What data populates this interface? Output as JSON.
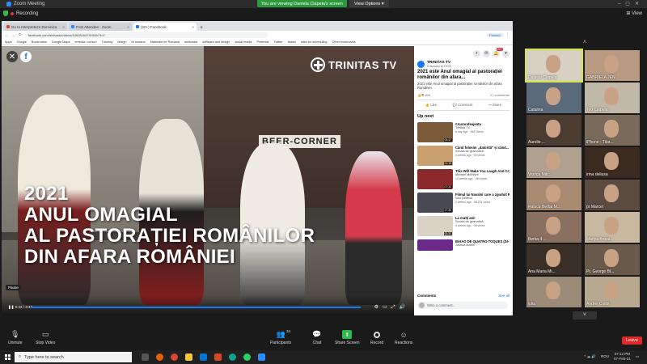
{
  "zoom": {
    "title": "Zoom Meeting",
    "share_banner": "You are viewing Daniela Ciapela's screen",
    "view_options": "View Options",
    "recording": "Recording",
    "view": "View"
  },
  "browser": {
    "tabs": [
      {
        "label": "Go to Interpreteze Dominica",
        "color": "#e53935"
      },
      {
        "label": "Post Attendee - Zoom",
        "color": "#2d8cff"
      },
      {
        "label": "(20+) Facebook",
        "color": "#1877f2"
      }
    ],
    "address": "facebook.com/trinitastv/videos/10828164731006/?t=0",
    "paused": "Paused",
    "bookmarks": [
      "Apps",
      "Google",
      "Bookmarks",
      "Google Maps",
      "emedia / cursuri",
      "Tutoring",
      "design",
      "fb romana",
      "Materiale de Romana",
      "dictionare",
      "software and design",
      "social media",
      "Pinterest",
      "Twitter",
      "teams",
      "sites for scheduling",
      "Other bookmarks"
    ]
  },
  "video": {
    "logo": "TRINITAS TV",
    "sign": "BEER-CORNER",
    "overlay_lines": [
      "2021",
      "ANUL OMAGIAL",
      "AL PASTORAȚIEI ROMÂNILOR",
      "DIN AFARA ROMÂNIEI"
    ],
    "close": "✕",
    "fb": "f",
    "pause_tip": "Pause",
    "time": "0:44 / 3:43"
  },
  "post": {
    "notif_count": "20+",
    "channel": "TRINITAS TV",
    "date": "5 January at 19:00 · ",
    "title": "2021 este Anul omagial al pastorației românilor din afara...",
    "desc": "2021 este Anul omagial al pastorației românilor din afara României",
    "reactions": "849",
    "comments_count": "27 comments",
    "like": "Like",
    "comment": "Comment",
    "share": "Share",
    "up_next": "Up next",
    "comments_label": "Comments",
    "see_all": "See all",
    "write_comment": "Write a comment..."
  },
  "up_next": [
    {
      "title": "#Aurorafeajenta",
      "channel": "Trinitas TV",
      "meta": "a day ago · 496 Views",
      "dur": "03:47",
      "color": "#7b5a3a"
    },
    {
      "title": "Când folosim „datorită\" și când...",
      "channel": "Școala de gramatică",
      "meta": "4 weeks ago · 53 views",
      "dur": "01:15",
      "color": "#c9a070"
    },
    {
      "title": "This Will Make You Laugh And Cry",
      "channel": "Michael McIntyre",
      "meta": "12 weeks ago · 4M views",
      "dur": "07:32",
      "color": "#8a2a2a"
    },
    {
      "title": "Filmul lui Navalnî care a zguduit Rusia",
      "channel": "Nou Delfinul",
      "meta": "2 weeks ago · 48,231 views",
      "dur": "17:30",
      "color": "#4a4a55"
    },
    {
      "title": "La mulți ani!",
      "channel": "Școala de gramatică",
      "meta": "3 weeks ago · 46 views",
      "dur": "00:31",
      "color": "#d9d2c5"
    },
    {
      "title": "BAIAO DE QUATRO TOQUES (Zé Miguel...",
      "channel": "Joshua Martin",
      "meta": "",
      "dur": "",
      "color": "#6b2a8a"
    }
  ],
  "participants": [
    {
      "name": "Daniela Ciapela",
      "bg": "#d8d0c2"
    },
    {
      "name": "GABRIELA JEN...",
      "bg": "#b89a80"
    },
    {
      "name": "Catalina",
      "bg": "#5a6a7a"
    },
    {
      "name": "Teo Ciapela",
      "bg": "#c2b8a8"
    },
    {
      "name": "Aurelie ...",
      "bg": "#4a3c30"
    },
    {
      "name": "iPhone - Tiba...",
      "bg": "#7a6a5a"
    },
    {
      "name": "Viorica Mitc...",
      "bg": "#b0a090"
    },
    {
      "name": "irina deliusa",
      "bg": "#3a2a20"
    },
    {
      "name": "Raluca Berba M...",
      "bg": "#a88a70"
    },
    {
      "name": "pr Marcel",
      "bg": "#5a4a40"
    },
    {
      "name": "Berka 4 ...",
      "bg": "#8a7060"
    },
    {
      "name": "Mariya Broza...",
      "bg": "#c8b8a0"
    },
    {
      "name": "Ana Maria Mi...",
      "bg": "#3a3028"
    },
    {
      "name": "Pr. George Bl...",
      "bg": "#6a5a4c"
    },
    {
      "name": "iulia",
      "bg": "#9a8a78"
    },
    {
      "name": "Andrei Colibi",
      "bg": "#b8a890"
    }
  ],
  "toolbar": {
    "unmute": "Unmute",
    "stop_video": "Stop Video",
    "participants": "Participants",
    "participants_count": "34",
    "chat": "Chat",
    "share_screen": "Share Screen",
    "record": "Record",
    "reactions": "Reactions",
    "leave": "Leave"
  },
  "taskbar": {
    "search": "Type here to search",
    "lang": "ROU",
    "time": "07:12 PM",
    "date": "07-Feb-21"
  }
}
